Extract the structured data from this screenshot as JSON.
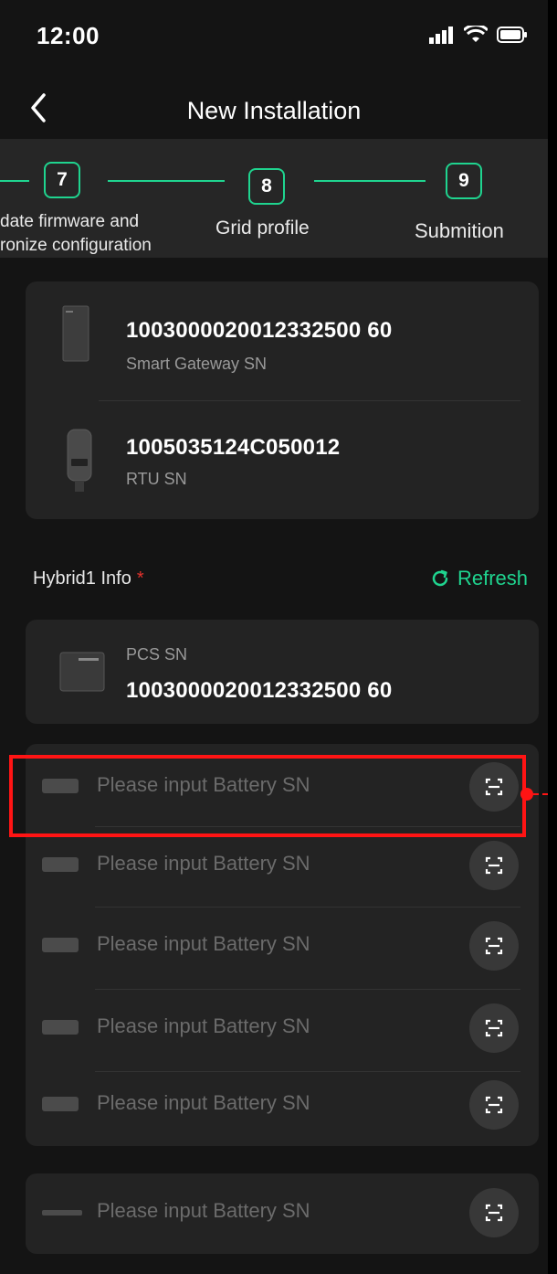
{
  "status_bar": {
    "time": "12:00"
  },
  "header": {
    "title": "New Installation"
  },
  "stepper": {
    "steps": [
      {
        "number": "7",
        "label_line1": "date firmware and",
        "label_line2": "ronize configuration"
      },
      {
        "number": "8",
        "label": "Grid profile"
      },
      {
        "number": "9",
        "label": "Submition"
      }
    ]
  },
  "devices": [
    {
      "sn": "1003000020012332500 60",
      "label": "Smart Gateway SN"
    },
    {
      "sn": "1005035124C050012",
      "label": "RTU SN"
    }
  ],
  "hybrid": {
    "title": "Hybrid1 Info",
    "required_mark": "*",
    "refresh_label": "Refresh",
    "pcs": {
      "label": "PCS SN",
      "sn": "1003000020012332500 60"
    }
  },
  "batteries": {
    "placeholder": "Please input Battery SN",
    "count": 6
  },
  "colors": {
    "accent": "#1fd48f",
    "highlight": "#ff1414",
    "required": "#e5322d"
  }
}
